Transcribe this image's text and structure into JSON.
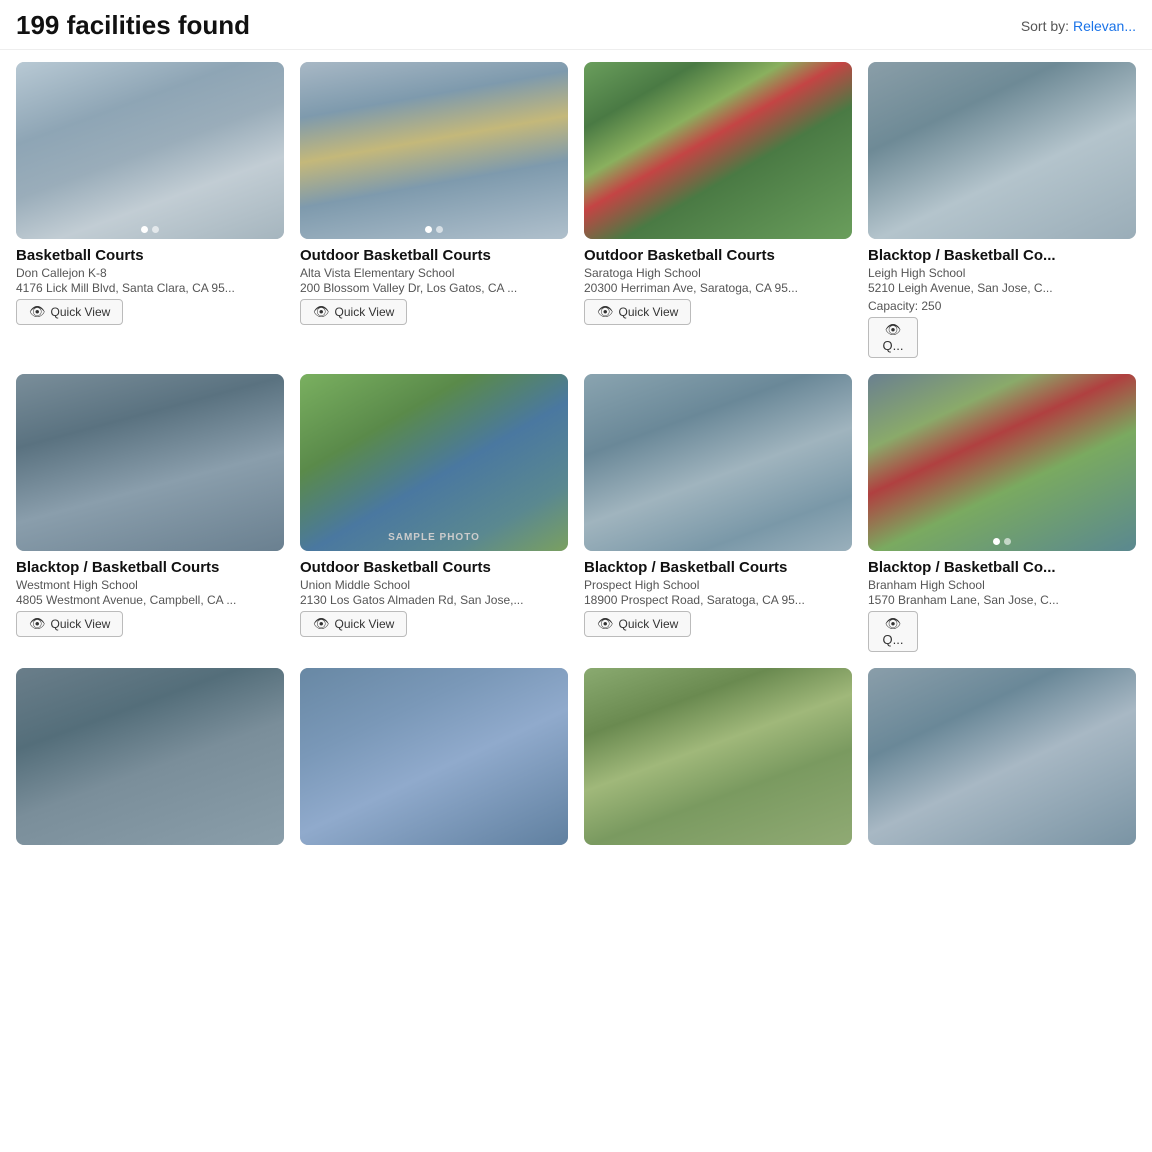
{
  "header": {
    "results_count": "199 facilities found",
    "sort_label": "Sort by:",
    "sort_value": "Relevan..."
  },
  "facilities": [
    {
      "id": 1,
      "title": "Basketball Courts",
      "school": "Don Callejon K-8",
      "address": "4176 Lick Mill Blvd, Santa Clara, CA 95...",
      "capacity": null,
      "img_class": "img-1",
      "has_dots": true,
      "dot_active": 0,
      "dot_count": 2,
      "sample_photo": false
    },
    {
      "id": 2,
      "title": "Outdoor Basketball Courts",
      "school": "Alta Vista Elementary School",
      "address": "200 Blossom Valley Dr, Los Gatos, CA ...",
      "capacity": null,
      "img_class": "img-2",
      "has_dots": true,
      "dot_active": 0,
      "dot_count": 2,
      "sample_photo": false
    },
    {
      "id": 3,
      "title": "Outdoor Basketball Courts",
      "school": "Saratoga High School",
      "address": "20300 Herriman Ave, Saratoga, CA 95...",
      "capacity": null,
      "img_class": "img-3",
      "has_dots": false,
      "dot_count": 0,
      "sample_photo": false
    },
    {
      "id": 4,
      "title": "Blacktop / Basketball Co...",
      "school": "Leigh High School",
      "address": "5210 Leigh Avenue, San Jose, C...",
      "capacity": "250",
      "img_class": "img-4",
      "has_dots": false,
      "dot_count": 0,
      "sample_photo": false,
      "partial": true
    },
    {
      "id": 5,
      "title": "Blacktop / Basketball Courts",
      "school": "Westmont High School",
      "address": "4805 Westmont Avenue, Campbell, CA ...",
      "capacity": null,
      "img_class": "img-5",
      "has_dots": false,
      "dot_count": 0,
      "sample_photo": false
    },
    {
      "id": 6,
      "title": "Outdoor Basketball Courts",
      "school": "Union Middle School",
      "address": "2130 Los Gatos Almaden Rd, San Jose,...",
      "capacity": null,
      "img_class": "img-6",
      "has_dots": false,
      "dot_count": 0,
      "sample_photo": true
    },
    {
      "id": 7,
      "title": "Blacktop / Basketball Courts",
      "school": "Prospect High School",
      "address": "18900 Prospect Road, Saratoga, CA 95...",
      "capacity": null,
      "img_class": "img-7",
      "has_dots": false,
      "dot_count": 0,
      "sample_photo": false
    },
    {
      "id": 8,
      "title": "Blacktop / Basketball Co...",
      "school": "Branham High School",
      "address": "1570 Branham Lane, San Jose, C...",
      "capacity": null,
      "img_class": "img-8",
      "has_dots": true,
      "dot_active": 0,
      "dot_count": 2,
      "sample_photo": false,
      "partial": true
    },
    {
      "id": 9,
      "title": "",
      "school": "",
      "address": "",
      "capacity": null,
      "img_class": "img-9",
      "has_dots": false,
      "dot_count": 0,
      "sample_photo": false,
      "bottom_row": true
    },
    {
      "id": 10,
      "title": "",
      "school": "",
      "address": "",
      "capacity": null,
      "img_class": "img-10",
      "has_dots": false,
      "dot_count": 0,
      "sample_photo": false,
      "bottom_row": true
    },
    {
      "id": 11,
      "title": "",
      "school": "",
      "address": "",
      "capacity": null,
      "img_class": "img-11",
      "has_dots": false,
      "dot_count": 0,
      "sample_photo": false,
      "bottom_row": true
    },
    {
      "id": 12,
      "title": "",
      "school": "",
      "address": "",
      "capacity": null,
      "img_class": "img-12",
      "has_dots": false,
      "dot_count": 0,
      "sample_photo": false,
      "bottom_row": true
    }
  ],
  "buttons": {
    "quick_view": "Quick View"
  }
}
